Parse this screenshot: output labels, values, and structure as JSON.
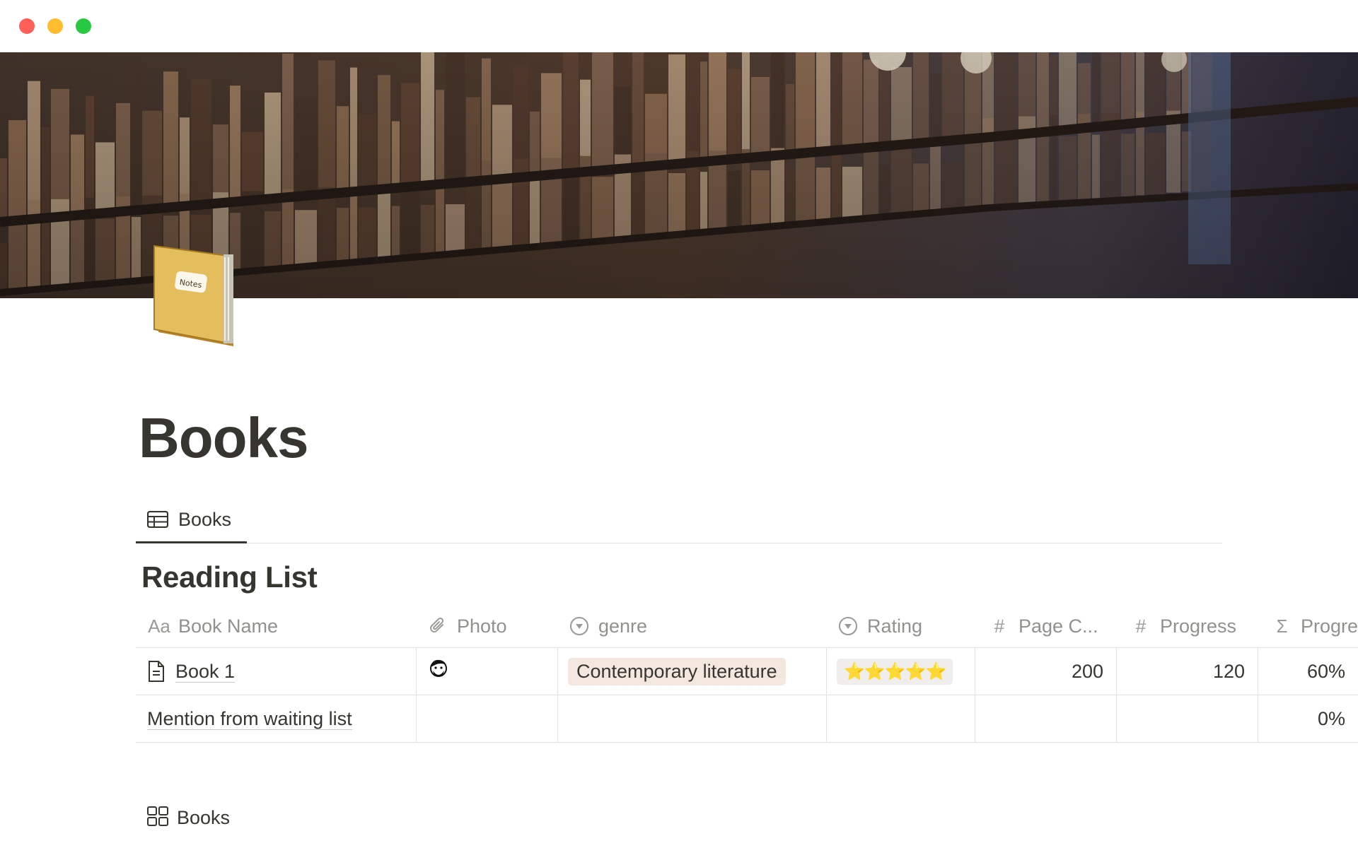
{
  "page": {
    "title": "Books"
  },
  "tabs": [
    {
      "label": "Books",
      "icon": "table-icon",
      "active": true
    }
  ],
  "database": {
    "title": "Reading List",
    "columns": [
      {
        "label": "Book Name",
        "icon": "text-property-icon",
        "icon_text": "Aa"
      },
      {
        "label": "Photo",
        "icon": "paperclip-icon"
      },
      {
        "label": "genre",
        "icon": "select-icon"
      },
      {
        "label": "Rating",
        "icon": "select-icon"
      },
      {
        "label": "Page C...",
        "icon": "number-icon",
        "icon_text": "#"
      },
      {
        "label": "Progress",
        "icon": "number-icon",
        "icon_text": "#"
      },
      {
        "label": "Progre",
        "icon": "formula-icon",
        "icon_text": "Σ"
      }
    ],
    "rows": [
      {
        "name": "Book 1",
        "photo": "avatar",
        "genre": "Contemporary literature",
        "rating": "⭐⭐⭐⭐⭐",
        "pages": "200",
        "progress": "120",
        "percent": "60%"
      },
      {
        "name": "Mention from waiting list",
        "photo": "",
        "genre": "",
        "rating": "",
        "pages": "",
        "progress": "",
        "percent": "0%"
      }
    ]
  },
  "bottom_view": {
    "label": "Books",
    "icon": "gallery-icon"
  },
  "colors": {
    "text": "#37352f",
    "muted": "#91918e",
    "border": "#e3e2e0",
    "genre_tag": "#f4e7e0",
    "rating_tag": "#efeeec"
  }
}
